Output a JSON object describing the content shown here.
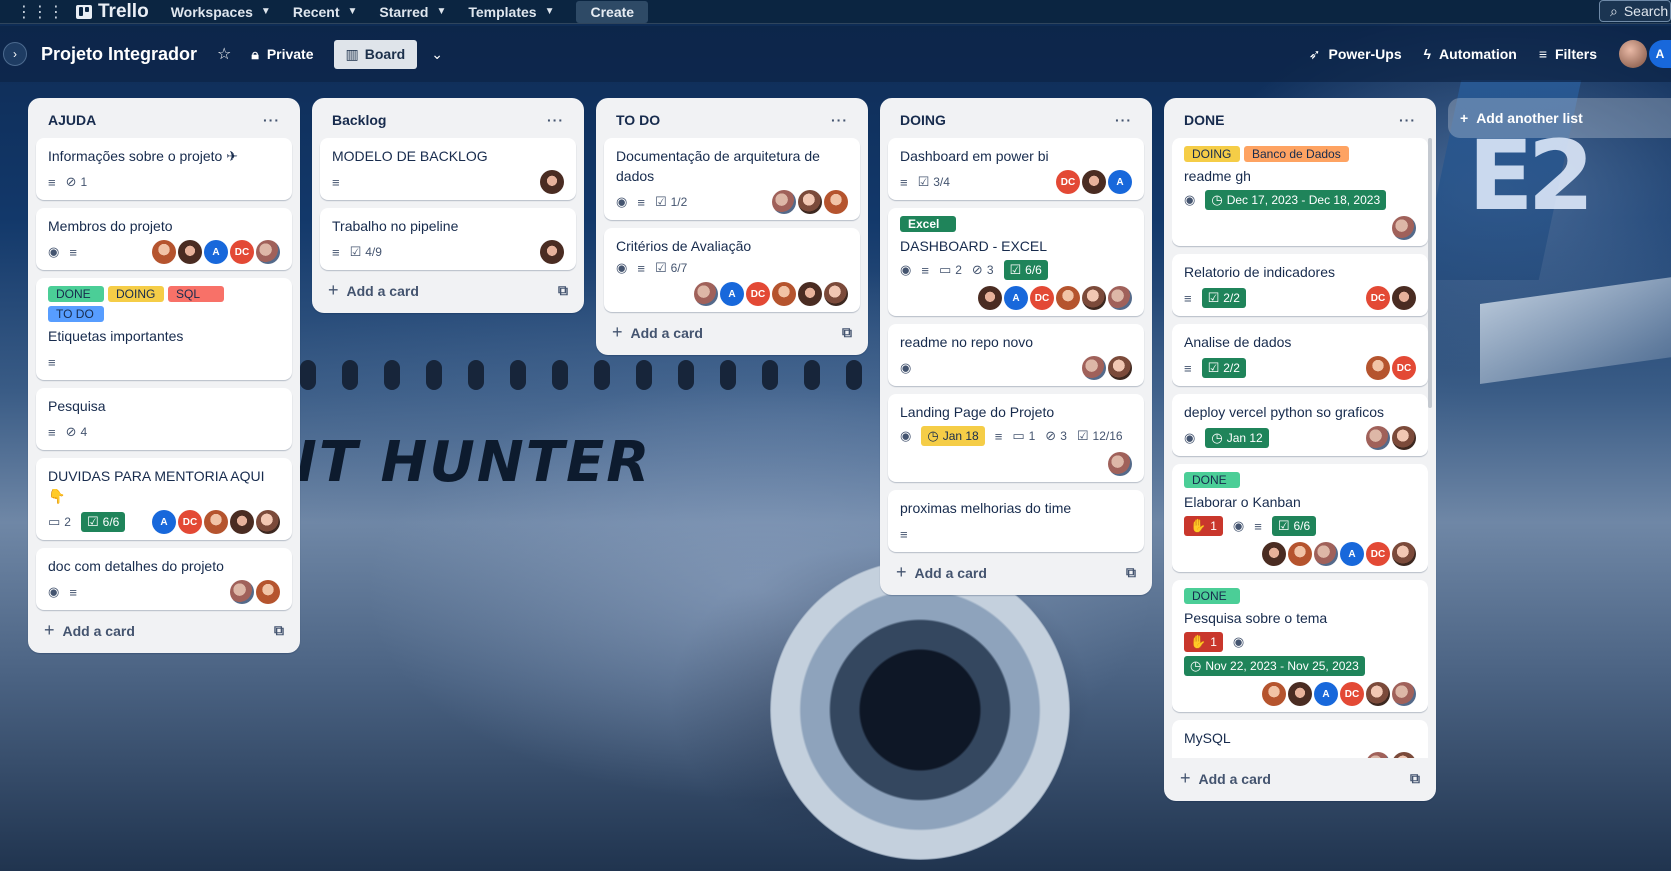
{
  "nav": {
    "brand": "Trello",
    "menu": [
      "Workspaces",
      "Recent",
      "Starred",
      "Templates"
    ],
    "create_label": "Create",
    "search_placeholder": "Search"
  },
  "board": {
    "title": "Projeto Integrador",
    "visibility": "Private",
    "view": "Board",
    "powerups": "Power-Ups",
    "automation": "Automation",
    "filters": "Filters",
    "member_initial": "A"
  },
  "background": {
    "text": "IT HUNTER",
    "tail": "E2"
  },
  "colors": {
    "green": "#1f845a",
    "red": "#c9372c",
    "yellow": "#f5cd47",
    "blue": "#1868db",
    "dc": "#e34935"
  },
  "lists": [
    {
      "title": "AJUDA",
      "add_label": "Add a card",
      "cards": [
        {
          "title": "Informações sobre o projeto ✈",
          "badges": [
            {
              "icon": "description-icon"
            },
            {
              "icon": "attachment-icon",
              "text": "1"
            }
          ]
        },
        {
          "title": "Membros do projeto",
          "badges": [
            {
              "icon": "watch-icon"
            },
            {
              "icon": "description-icon"
            }
          ],
          "members": [
            "photo4",
            "photo2",
            "A",
            "DC",
            "photo3"
          ]
        },
        {
          "labels": [
            [
              "DONE",
              "green"
            ],
            [
              "DOING",
              "yellow"
            ],
            [
              "SQL",
              "red"
            ],
            [
              "TO DO",
              "blue"
            ]
          ],
          "title": "Etiquetas importantes",
          "badges": [
            {
              "icon": "description-icon"
            }
          ]
        },
        {
          "title": "Pesquisa",
          "badges": [
            {
              "icon": "description-icon"
            },
            {
              "icon": "attachment-icon",
              "text": "4"
            }
          ]
        },
        {
          "title": "DUVIDAS PARA MENTORIA AQUI 👇",
          "badges": [
            {
              "icon": "comment-icon",
              "text": "2"
            },
            {
              "icon": "checklist-icon",
              "text": "6/6",
              "style": "green"
            }
          ],
          "members": [
            "A",
            "DC",
            "photo4",
            "photo2",
            "photo1"
          ]
        },
        {
          "title": "doc com detalhes do projeto",
          "badges": [
            {
              "icon": "watch-icon"
            },
            {
              "icon": "description-icon"
            }
          ],
          "members": [
            "photo3",
            "photo4"
          ]
        }
      ]
    },
    {
      "title": "Backlog",
      "add_label": "Add a card",
      "cards": [
        {
          "title": "MODELO DE BACKLOG",
          "badges": [
            {
              "icon": "description-icon"
            }
          ],
          "members": [
            "photo2"
          ]
        },
        {
          "title": "Trabalho no pipeline",
          "badges": [
            {
              "icon": "description-icon"
            },
            {
              "icon": "checklist-icon",
              "text": "4/9"
            }
          ],
          "members": [
            "photo2"
          ]
        }
      ]
    },
    {
      "title": "TO DO",
      "add_label": "Add a card",
      "cards": [
        {
          "title": "Documentação de arquitetura de dados",
          "badges": [
            {
              "icon": "watch-icon"
            },
            {
              "icon": "description-icon"
            },
            {
              "icon": "checklist-icon",
              "text": "1/2"
            }
          ],
          "members": [
            "photo3",
            "photo1",
            "photo4"
          ]
        },
        {
          "title": "Critérios de Avaliação",
          "badges": [
            {
              "icon": "watch-icon"
            },
            {
              "icon": "description-icon"
            },
            {
              "icon": "checklist-icon",
              "text": "6/7"
            }
          ],
          "members_row": [
            "photo3",
            "A",
            "DC",
            "photo4",
            "photo2",
            "photo1"
          ]
        }
      ]
    },
    {
      "title": "DOING",
      "add_label": "Add a card",
      "cards": [
        {
          "title": "Dashboard em power bi",
          "badges": [
            {
              "icon": "description-icon"
            },
            {
              "icon": "checklist-icon",
              "text": "3/4"
            }
          ],
          "members": [
            "DC",
            "photo2",
            "A"
          ]
        },
        {
          "labels": [
            [
              "Excel",
              "darkgreen"
            ]
          ],
          "title": "DASHBOARD - EXCEL",
          "badges": [
            {
              "icon": "watch-icon"
            },
            {
              "icon": "description-icon"
            },
            {
              "icon": "comment-icon",
              "text": "2"
            },
            {
              "icon": "attachment-icon",
              "text": "3"
            },
            {
              "icon": "checklist-icon",
              "text": "6/6",
              "style": "green"
            }
          ],
          "members_row": [
            "photo2",
            "A",
            "DC",
            "photo4",
            "photo1",
            "photo3"
          ]
        },
        {
          "title": "readme no repo novo",
          "badges": [
            {
              "icon": "watch-icon"
            }
          ],
          "members": [
            "photo3",
            "photo1"
          ]
        },
        {
          "title": "Landing Page do Projeto",
          "badges": [
            {
              "icon": "watch-icon"
            },
            {
              "icon": "clock-icon",
              "text": "Jan 18",
              "style": "yellow"
            },
            {
              "icon": "description-icon"
            },
            {
              "icon": "comment-icon",
              "text": "1"
            },
            {
              "icon": "attachment-icon",
              "text": "3"
            },
            {
              "icon": "checklist-icon",
              "text": "12/16"
            }
          ],
          "members_row": [
            "photo3"
          ]
        },
        {
          "title": "proximas melhorias do time",
          "badges": [
            {
              "icon": "description-icon"
            }
          ]
        }
      ]
    },
    {
      "title": "DONE",
      "add_label": "Add a card",
      "cards": [
        {
          "labels": [
            [
              "DOING",
              "yellow"
            ],
            [
              "Banco de Dados",
              "orange"
            ]
          ],
          "title": "readme gh",
          "badges": [
            {
              "icon": "watch-icon"
            },
            {
              "icon": "clock-icon",
              "text": "Dec 17, 2023 - Dec 18, 2023",
              "style": "green"
            }
          ],
          "members_row": [
            "photo3"
          ]
        },
        {
          "title": "Relatorio de indicadores",
          "badges": [
            {
              "icon": "description-icon"
            },
            {
              "icon": "checklist-icon",
              "text": "2/2",
              "style": "green"
            }
          ],
          "members": [
            "DC",
            "photo2"
          ]
        },
        {
          "title": "Analise de dados",
          "badges": [
            {
              "icon": "description-icon"
            },
            {
              "icon": "checklist-icon",
              "text": "2/2",
              "style": "green"
            }
          ],
          "members": [
            "photo4",
            "DC"
          ]
        },
        {
          "title": "deploy vercel python so graficos",
          "badges": [
            {
              "icon": "watch-icon"
            },
            {
              "icon": "clock-icon",
              "text": "Jan 12",
              "style": "green"
            }
          ],
          "members": [
            "photo3",
            "photo1"
          ]
        },
        {
          "labels": [
            [
              "DONE",
              "green"
            ]
          ],
          "title": "Elaborar o Kanban",
          "badges": [
            {
              "icon": "vote-icon",
              "text": "1",
              "style": "red"
            },
            {
              "icon": "watch-icon"
            },
            {
              "icon": "description-icon"
            },
            {
              "icon": "checklist-icon",
              "text": "6/6",
              "style": "green"
            }
          ],
          "members_row": [
            "photo2",
            "photo4",
            "photo3",
            "A",
            "DC",
            "photo1"
          ]
        },
        {
          "labels": [
            [
              "DONE",
              "green"
            ]
          ],
          "title": "Pesquisa sobre o tema",
          "badges": [
            {
              "icon": "vote-icon",
              "text": "1",
              "style": "red"
            },
            {
              "icon": "watch-icon"
            },
            {
              "icon": "clock-icon",
              "text": "Nov 22, 2023 - Nov 25, 2023",
              "style": "green"
            }
          ],
          "members_row": [
            "photo4",
            "photo2",
            "A",
            "DC",
            "photo1",
            "photo3"
          ]
        },
        {
          "title": "MySQL",
          "badges": [
            {
              "icon": "watch-icon"
            },
            {
              "icon": "description-icon"
            }
          ],
          "members": [
            "photo3",
            "photo1"
          ]
        }
      ]
    }
  ],
  "add_list_label": "Add another list"
}
